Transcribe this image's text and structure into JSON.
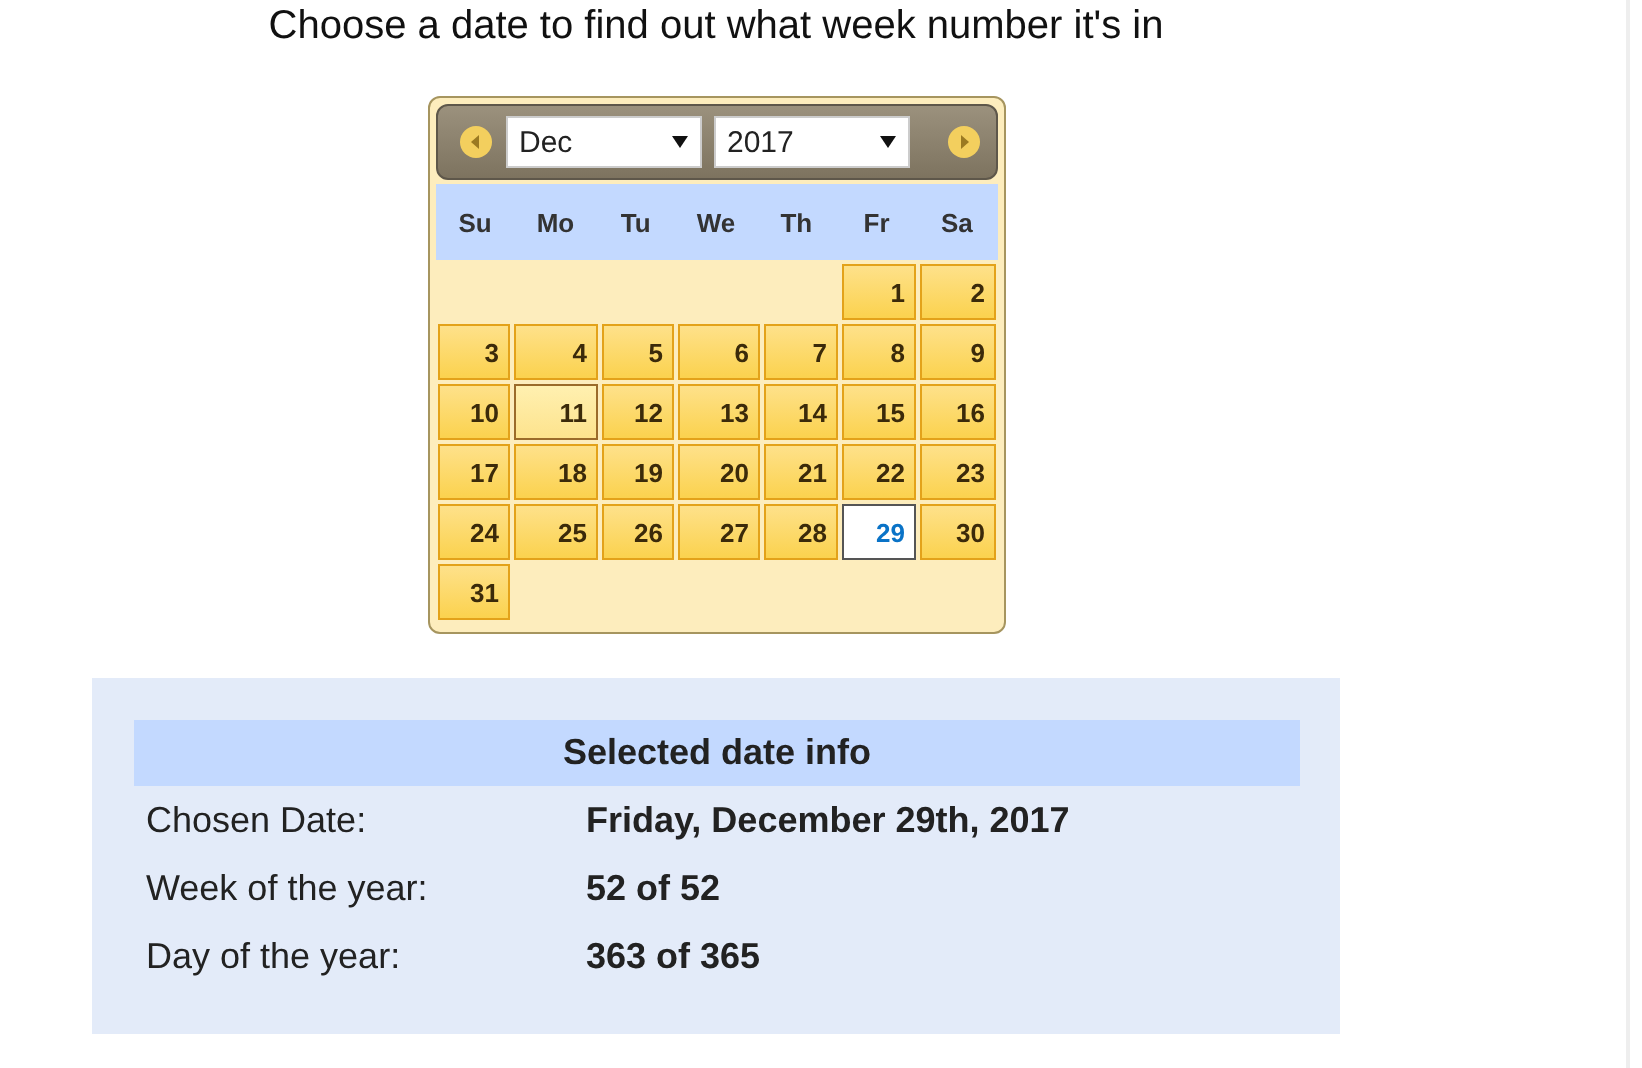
{
  "heading": "Choose a date to find out what week number it's in",
  "calendar": {
    "month": "Dec",
    "year": "2017",
    "weekdays": [
      "Su",
      "Mo",
      "Tu",
      "We",
      "Th",
      "Fr",
      "Sa"
    ],
    "weeks": [
      {
        "days": [
          {
            "label": "1",
            "today": false,
            "selected": false
          },
          {
            "label": "2",
            "today": false,
            "selected": false
          }
        ]
      },
      {
        "days": [
          {
            "label": "3",
            "today": false,
            "selected": false
          },
          {
            "label": "4",
            "today": false,
            "selected": false
          },
          {
            "label": "5",
            "today": false,
            "selected": false
          },
          {
            "label": "6",
            "today": false,
            "selected": false
          },
          {
            "label": "7",
            "today": false,
            "selected": false
          },
          {
            "label": "8",
            "today": false,
            "selected": false
          },
          {
            "label": "9",
            "today": false,
            "selected": false
          }
        ]
      },
      {
        "days": [
          {
            "label": "10",
            "today": false,
            "selected": false
          },
          {
            "label": "11",
            "today": true,
            "selected": false
          },
          {
            "label": "12",
            "today": false,
            "selected": false
          },
          {
            "label": "13",
            "today": false,
            "selected": false
          },
          {
            "label": "14",
            "today": false,
            "selected": false
          },
          {
            "label": "15",
            "today": false,
            "selected": false
          },
          {
            "label": "16",
            "today": false,
            "selected": false
          }
        ]
      },
      {
        "days": [
          {
            "label": "17",
            "today": false,
            "selected": false
          },
          {
            "label": "18",
            "today": false,
            "selected": false
          },
          {
            "label": "19",
            "today": false,
            "selected": false
          },
          {
            "label": "20",
            "today": false,
            "selected": false
          },
          {
            "label": "21",
            "today": false,
            "selected": false
          },
          {
            "label": "22",
            "today": false,
            "selected": false
          },
          {
            "label": "23",
            "today": false,
            "selected": false
          }
        ]
      },
      {
        "days": [
          {
            "label": "24",
            "today": false,
            "selected": false
          },
          {
            "label": "25",
            "today": false,
            "selected": false
          },
          {
            "label": "26",
            "today": false,
            "selected": false
          },
          {
            "label": "27",
            "today": false,
            "selected": false
          },
          {
            "label": "28",
            "today": false,
            "selected": false
          },
          {
            "label": "29",
            "today": false,
            "selected": true
          },
          {
            "label": "30",
            "today": false,
            "selected": false
          }
        ]
      },
      {
        "days": [
          {
            "label": "31",
            "today": false,
            "selected": false
          }
        ]
      }
    ]
  },
  "info": {
    "title": "Selected date info",
    "rows": [
      {
        "label": "Chosen Date:",
        "value": "Friday, December 29th, 2017"
      },
      {
        "label": "Week of the year:",
        "value": "52 of 52"
      },
      {
        "label": "Day of the year:",
        "value": "363 of 365"
      }
    ]
  }
}
